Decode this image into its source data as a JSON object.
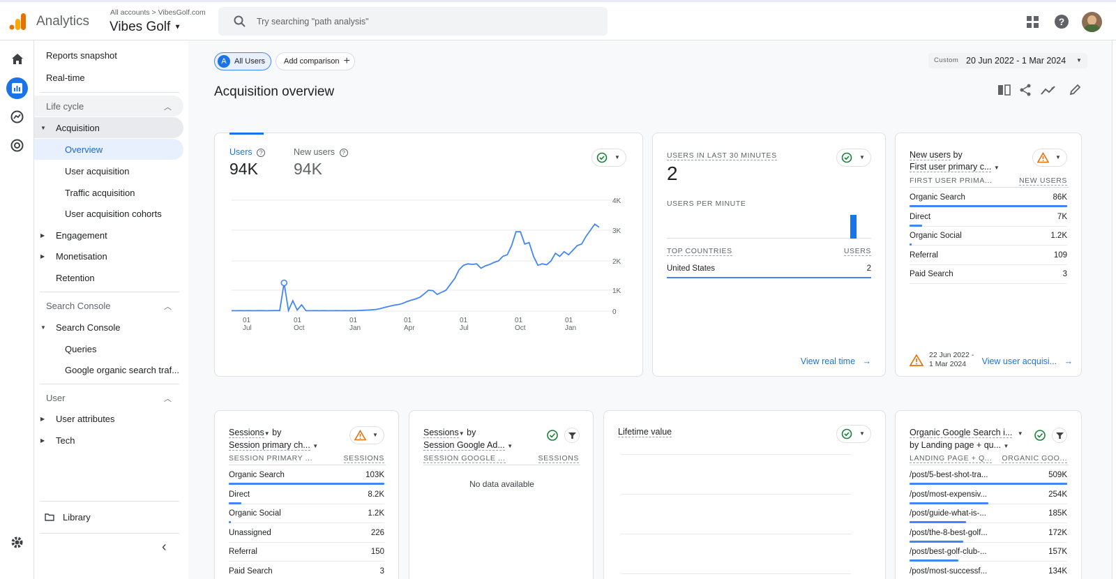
{
  "header": {
    "app_name": "Analytics",
    "breadcrumb_all": "All accounts",
    "breadcrumb_sep": ">",
    "breadcrumb_account": "VibesGolf.com",
    "property": "Vibes Golf",
    "search_placeholder": "Try searching \"path analysis\""
  },
  "nav": {
    "items": [
      {
        "label": "Reports snapshot"
      },
      {
        "label": "Real-time"
      },
      {
        "label": "Life cycle"
      },
      {
        "label": "Acquisition"
      },
      {
        "label": "Overview"
      },
      {
        "label": "User acquisition"
      },
      {
        "label": "Traffic acquisition"
      },
      {
        "label": "User acquisition cohorts"
      },
      {
        "label": "Engagement"
      },
      {
        "label": "Monetisation"
      },
      {
        "label": "Retention"
      },
      {
        "label": "Search Console"
      },
      {
        "label": "Search Console"
      },
      {
        "label": "Queries"
      },
      {
        "label": "Google organic search traf..."
      },
      {
        "label": "User"
      },
      {
        "label": "User attributes"
      },
      {
        "label": "Tech"
      }
    ],
    "library": "Library"
  },
  "toolbar": {
    "segment_letter": "A",
    "segment": "All Users",
    "add_comparison": "Add comparison",
    "date_custom": "Custom",
    "date_range": "20 Jun 2022 - 1 Mar 2024",
    "page_title": "Acquisition overview"
  },
  "users_card": {
    "metric1_label": "Users",
    "metric1_value": "94K",
    "metric2_label": "New users",
    "metric2_value": "94K"
  },
  "chart_data": {
    "type": "line",
    "x_tick_labels": [
      [
        "01",
        "Jul"
      ],
      [
        "01",
        "Oct"
      ],
      [
        "01",
        "Jan"
      ],
      [
        "01",
        "Apr"
      ],
      [
        "01",
        "Jul"
      ],
      [
        "01",
        "Oct"
      ],
      [
        "01",
        "Jan"
      ]
    ],
    "y_ticks": [
      "0",
      "1K",
      "2K",
      "3K",
      "4K"
    ],
    "ylim": [
      0,
      4000
    ],
    "series": [
      {
        "color": "#4285f4",
        "values": [
          20,
          20,
          25,
          20,
          22,
          20,
          25,
          22,
          20,
          25,
          30,
          25,
          1250,
          30,
          500,
          50,
          300,
          20,
          20,
          25,
          20,
          22,
          20,
          20,
          25,
          20,
          22,
          20,
          25,
          30,
          40,
          50,
          60,
          80,
          120,
          180,
          230,
          280,
          310,
          360,
          450,
          520,
          580,
          660,
          820,
          1000,
          980,
          800,
          900,
          1000,
          1200,
          1400,
          1700,
          1850,
          1900,
          1880,
          1900,
          1750,
          1830,
          1880,
          1950,
          2000,
          2150,
          2200,
          2500,
          2950,
          2950,
          2550,
          2600,
          2150,
          1850,
          1900,
          1870,
          2000,
          2250,
          2150,
          2300,
          2200,
          2350,
          2500,
          2550,
          2800,
          3000,
          3200,
          3100
        ]
      }
    ]
  },
  "realtime_card": {
    "title": "Users in last 30 minutes",
    "value": "2",
    "per_minute": "Users per minute",
    "per_minute_bar_value": 2,
    "countries_header": "Top countries",
    "users_header": "Users",
    "countries": [
      {
        "name": "United States",
        "value": "2"
      }
    ],
    "link": "View real time"
  },
  "newusers_card": {
    "title1": "New users",
    "title_by": "by",
    "title2": "First user primary c...",
    "col1": "First user prima...",
    "col2": "New users",
    "rows": [
      {
        "label": "Organic Search",
        "value": "86K",
        "pct": 1.0
      },
      {
        "label": "Direct",
        "value": "7K",
        "pct": 0.08
      },
      {
        "label": "Organic Social",
        "value": "1.2K",
        "pct": 0.014
      },
      {
        "label": "Referral",
        "value": "109",
        "pct": 0.0
      },
      {
        "label": "Paid Search",
        "value": "3",
        "pct": 0.0
      }
    ],
    "date_line1": "22 Jun 2022 -",
    "date_line2": "1 Mar 2024",
    "link": "View user acquisi..."
  },
  "sessions_card": {
    "title1": "Sessions",
    "title_by": "by",
    "title2": "Session primary ch...",
    "col1": "Session primary ...",
    "col2": "Sessions",
    "rows": [
      {
        "label": "Organic Search",
        "value": "103K",
        "pct": 1.0
      },
      {
        "label": "Direct",
        "value": "8.2K",
        "pct": 0.08
      },
      {
        "label": "Organic Social",
        "value": "1.2K",
        "pct": 0.012
      },
      {
        "label": "Unassigned",
        "value": "226",
        "pct": 0.0
      },
      {
        "label": "Referral",
        "value": "150",
        "pct": 0.0
      },
      {
        "label": "Paid Search",
        "value": "3",
        "pct": 0.0
      }
    ]
  },
  "ads_card": {
    "title1": "Sessions",
    "title_by": "by",
    "title2": "Session Google Ad...",
    "col1": "Session Google ...",
    "col2": "Sessions",
    "empty": "No data available"
  },
  "ltv_card": {
    "title": "Lifetime value"
  },
  "organic_card": {
    "title1": "Organic Google Search i...",
    "title2": "by Landing page + qu...",
    "col1": "Landing page + Q...",
    "col2": "Organic goo...",
    "rows": [
      {
        "label": "/post/5-best-shot-tra...",
        "value": "509K",
        "pct": 1.0
      },
      {
        "label": "/post/most-expensiv...",
        "value": "254K",
        "pct": 0.5
      },
      {
        "label": "/post/guide-what-is-...",
        "value": "185K",
        "pct": 0.36
      },
      {
        "label": "/post/the-8-best-golf...",
        "value": "172K",
        "pct": 0.34
      },
      {
        "label": "/post/best-golf-club-...",
        "value": "157K",
        "pct": 0.31
      },
      {
        "label": "/post/most-successf...",
        "value": "134K",
        "pct": 0.26
      }
    ]
  }
}
